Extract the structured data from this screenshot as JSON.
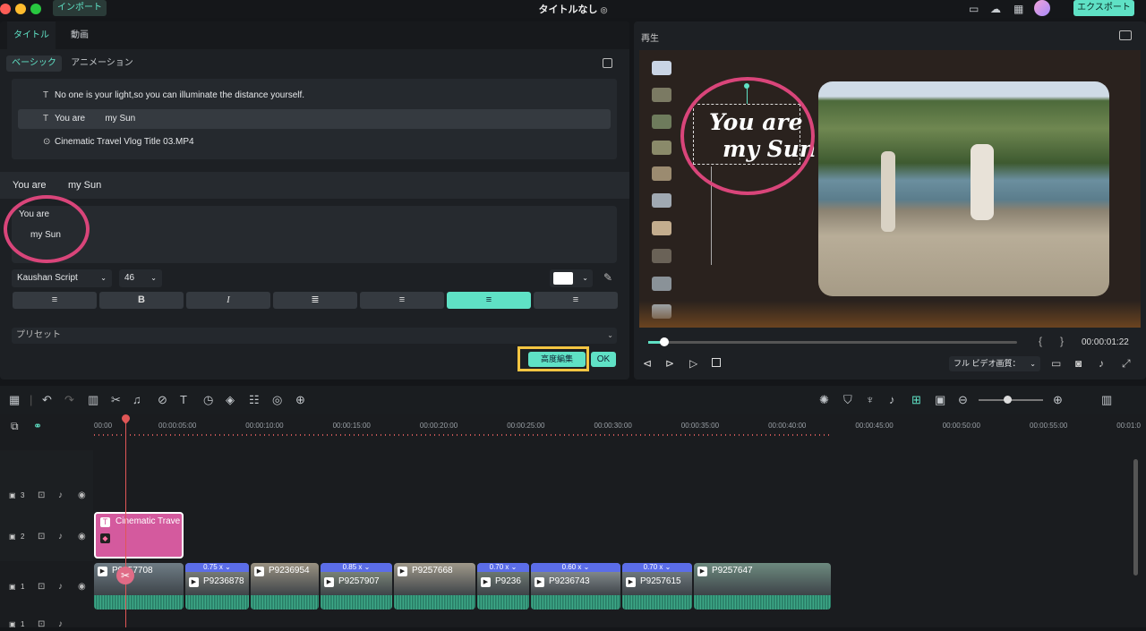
{
  "topbar": {
    "import_label": "インポート",
    "title": "タイトルなし",
    "export_label": "エクスポート"
  },
  "left": {
    "tabs": [
      "タイトル",
      "動画"
    ],
    "subtabs": [
      "ベーシック",
      "アニメーション"
    ],
    "list": [
      "No one is your light,so you can illuminate the distance yourself.",
      "You are        my Sun",
      "Cinematic Travel Vlog Title 03.MP4"
    ],
    "edit_header": "You are        my Sun",
    "text_line1": "You are",
    "text_line2": "my Sun",
    "font": "Kaushan Script",
    "size": "46",
    "format": {
      "b": "B",
      "i": "I"
    },
    "preset": "プリセット",
    "advanced_label": "高度編集",
    "ok_label": "OK"
  },
  "right": {
    "label": "再生",
    "preview_title_1": "You are",
    "preview_title_2": "my Sun",
    "timecode": "00:00:01:22",
    "quality": "フル ビデオ画質：",
    "brace_l": "{",
    "brace_r": "}"
  },
  "timeline": {
    "ticks": [
      "00:00",
      "00:00:05:00",
      "00:00:10:00",
      "00:00:15:00",
      "00:00:20:00",
      "00:00:25:00",
      "00:00:30:00",
      "00:00:35:00",
      "00:00:40:00",
      "00:00:45:00",
      "00:00:50:00",
      "00:00:55:00",
      "00:01:0"
    ],
    "tracks": [
      "3",
      "2",
      "1",
      "1"
    ],
    "title_clip": "Cinematic Trave",
    "clips": [
      {
        "name": "P9257708",
        "speed": ""
      },
      {
        "name": "P9236878",
        "speed": "0.75 x"
      },
      {
        "name": "P9236954",
        "speed": ""
      },
      {
        "name": "P9257907",
        "speed": "0.85 x"
      },
      {
        "name": "P9257668",
        "speed": ""
      },
      {
        "name": "P9236",
        "speed": "0.70 x"
      },
      {
        "name": "P9236743",
        "speed": "0.60 x"
      },
      {
        "name": "P9257615",
        "speed": "0.70 x"
      },
      {
        "name": "P9257647",
        "speed": ""
      }
    ]
  },
  "colors": {
    "accent": "#5fe1c5",
    "highlight": "#d9457a",
    "title_clip": "#d45a9e",
    "speed_badge": "#5b6de8",
    "advanced_border": "#f4c542"
  }
}
